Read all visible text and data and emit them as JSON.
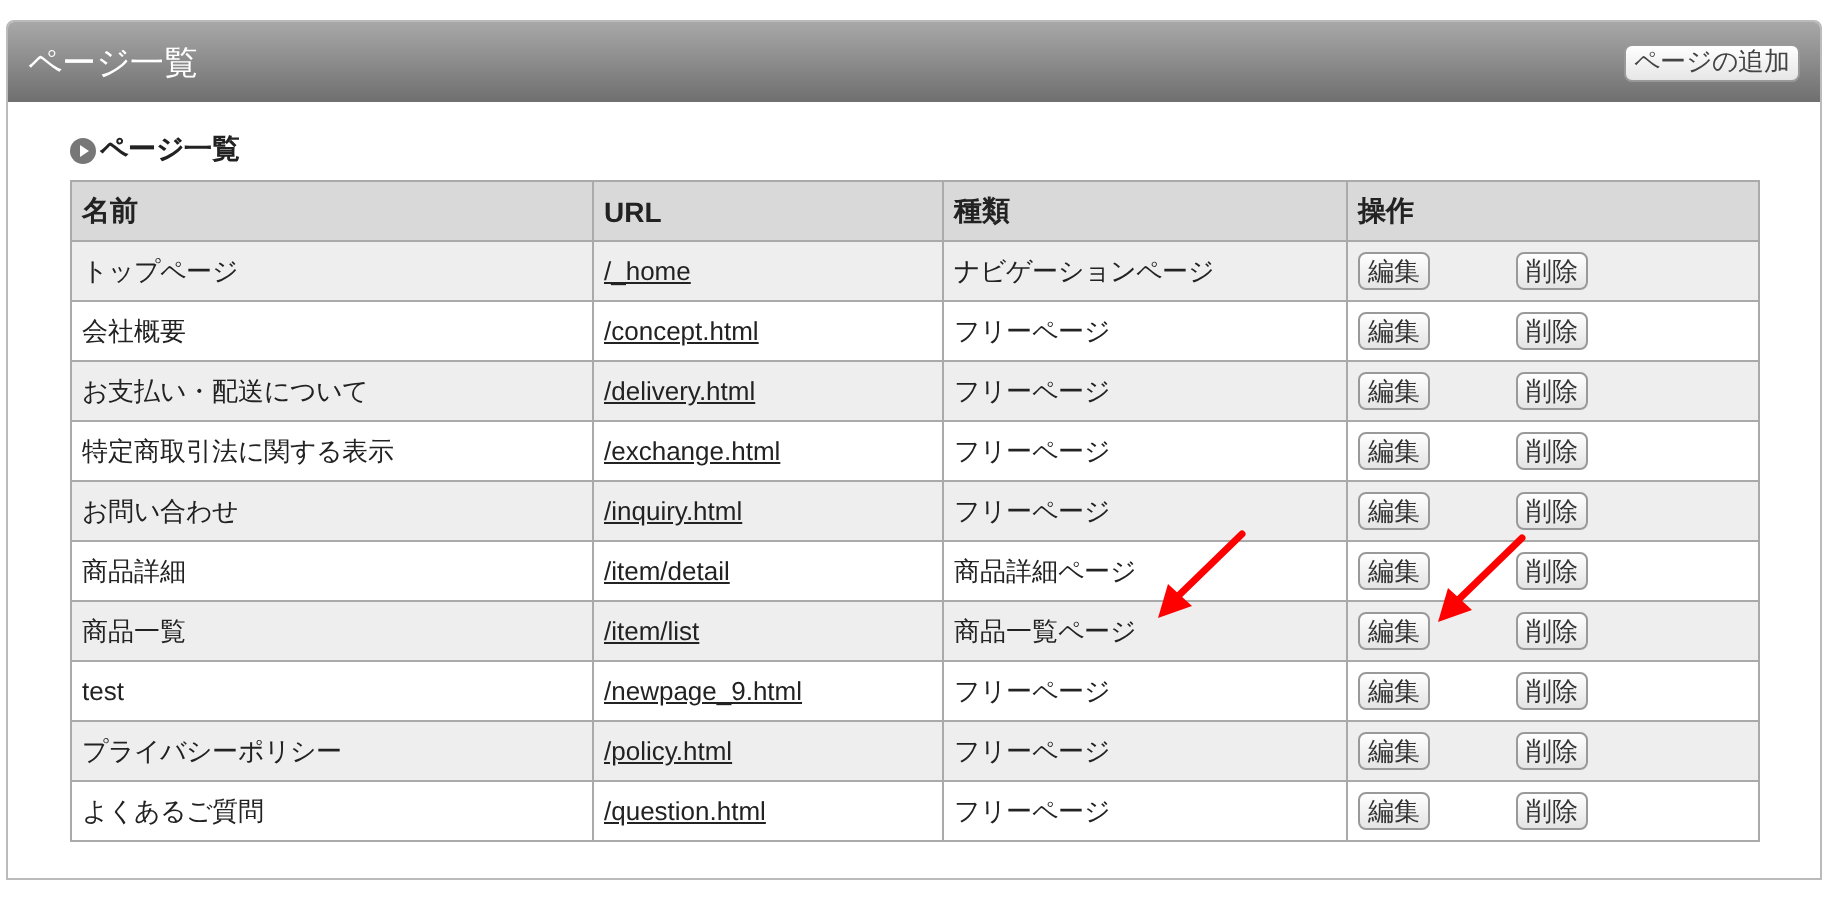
{
  "panel": {
    "title": "ページ一覧",
    "add_button": "ページの追加"
  },
  "section": {
    "title": "ページ一覧"
  },
  "table": {
    "columns": [
      "名前",
      "URL",
      "種類",
      "操作"
    ],
    "rows": [
      {
        "name": "トップページ",
        "url": "/_home",
        "type": "ナビゲーションページ",
        "edit": "編集",
        "delete": "削除"
      },
      {
        "name": "会社概要",
        "url": "/concept.html",
        "type": "フリーページ",
        "edit": "編集",
        "delete": "削除"
      },
      {
        "name": "お支払い・配送について",
        "url": "/delivery.html",
        "type": "フリーページ",
        "edit": "編集",
        "delete": "削除"
      },
      {
        "name": "特定商取引法に関する表示",
        "url": "/exchange.html",
        "type": "フリーページ",
        "edit": "編集",
        "delete": "削除"
      },
      {
        "name": "お問い合わせ",
        "url": "/inquiry.html",
        "type": "フリーページ",
        "edit": "編集",
        "delete": "削除"
      },
      {
        "name": "商品詳細",
        "url": "/item/detail",
        "type": "商品詳細ページ",
        "edit": "編集",
        "delete": "削除"
      },
      {
        "name": "商品一覧",
        "url": "/item/list",
        "type": "商品一覧ページ",
        "edit": "編集",
        "delete": "削除"
      },
      {
        "name": "test",
        "url": "/newpage_9.html",
        "type": "フリーページ",
        "edit": "編集",
        "delete": "削除"
      },
      {
        "name": "プライバシーポリシー",
        "url": "/policy.html",
        "type": "フリーページ",
        "edit": "編集",
        "delete": "削除"
      },
      {
        "name": "よくあるご質問",
        "url": "/question.html",
        "type": "フリーページ",
        "edit": "編集",
        "delete": "削除"
      }
    ]
  },
  "annotations": [
    {
      "kind": "arrow"
    },
    {
      "kind": "arrow"
    }
  ]
}
